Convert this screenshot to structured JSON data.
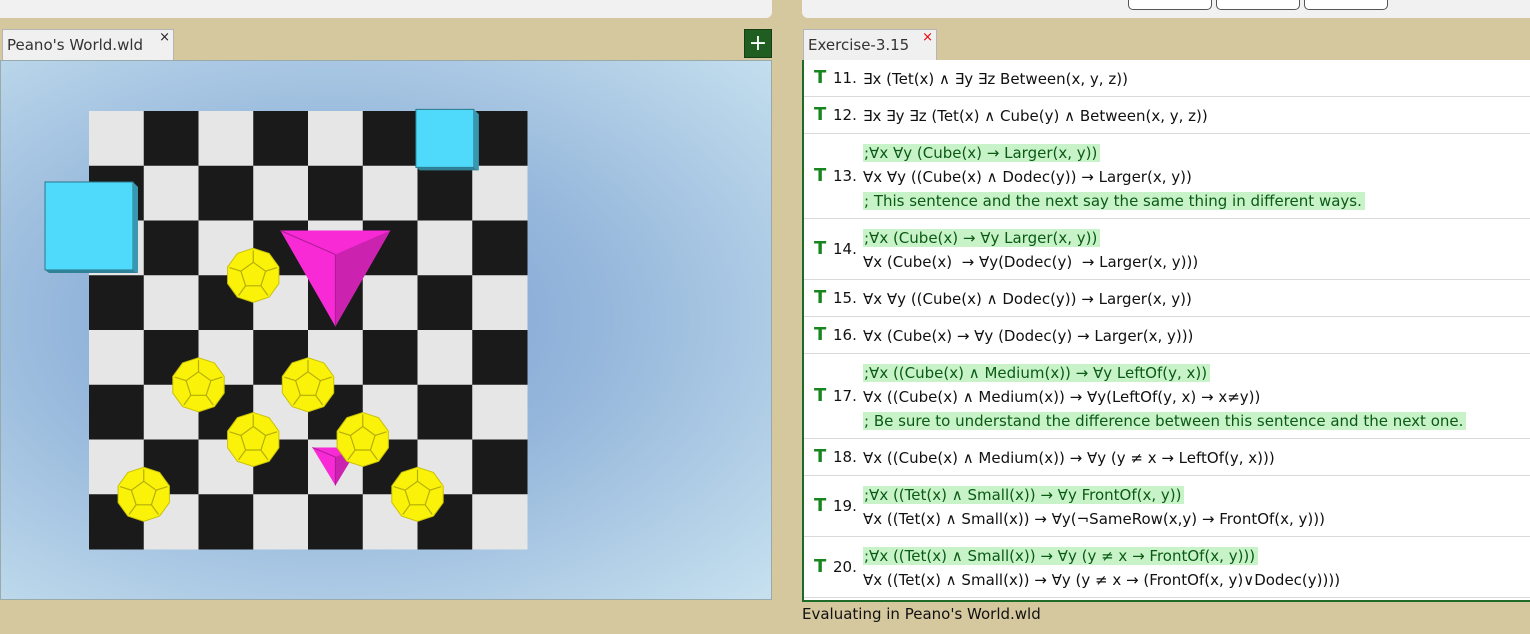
{
  "world_tab": {
    "label": "Peano's World.wld",
    "close": "×"
  },
  "add_button": {
    "label": "+"
  },
  "exercise_tab": {
    "label": "Exercise-3.15",
    "close": "×"
  },
  "status": "Evaluating in Peano's World.wld",
  "sentences": [
    {
      "truth": "T",
      "number": "11.",
      "lines": [
        {
          "text": "∃x (Tet(x) ∧ ∃y ∃z Between(x, y, z))",
          "comment": false
        }
      ]
    },
    {
      "truth": "T",
      "number": "12.",
      "lines": [
        {
          "text": "∃x ∃y ∃z (Tet(x) ∧ Cube(y) ∧ Between(x, y, z))",
          "comment": false
        }
      ]
    },
    {
      "truth": "T",
      "number": "13.",
      "lines": [
        {
          "text": ";∀x ∀y (Cube(x) → Larger(x, y))",
          "comment": true
        },
        {
          "text": "∀x ∀y ((Cube(x) ∧ Dodec(y)) → Larger(x, y))",
          "comment": false
        },
        {
          "text": "; This sentence and the next say the same thing in different ways.",
          "comment": true
        }
      ]
    },
    {
      "truth": "T",
      "number": "14.",
      "lines": [
        {
          "text": ";∀x (Cube(x) → ∀y Larger(x, y))",
          "comment": true
        },
        {
          "text": "∀x (Cube(x)  → ∀y(Dodec(y)  → Larger(x, y)))",
          "comment": false
        }
      ]
    },
    {
      "truth": "T",
      "number": "15.",
      "lines": [
        {
          "text": "∀x ∀y ((Cube(x) ∧ Dodec(y)) → Larger(x, y))",
          "comment": false
        }
      ]
    },
    {
      "truth": "T",
      "number": "16.",
      "lines": [
        {
          "text": "∀x (Cube(x) → ∀y (Dodec(y) → Larger(x, y)))",
          "comment": false
        }
      ]
    },
    {
      "truth": "T",
      "number": "17.",
      "lines": [
        {
          "text": ";∀x ((Cube(x) ∧ Medium(x)) → ∀y LeftOf(y, x))",
          "comment": true
        },
        {
          "text": "∀x ((Cube(x) ∧ Medium(x)) → ∀y(LeftOf(y, x) → x≠y))",
          "comment": false
        },
        {
          "text": "; Be sure to understand the difference between this sentence and the next one.",
          "comment": true
        }
      ]
    },
    {
      "truth": "T",
      "number": "18.",
      "lines": [
        {
          "text": "∀x ((Cube(x) ∧ Medium(x)) → ∀y (y ≠ x → LeftOf(y, x)))",
          "comment": false
        }
      ]
    },
    {
      "truth": "T",
      "number": "19.",
      "lines": [
        {
          "text": ";∀x ((Tet(x) ∧ Small(x)) → ∀y FrontOf(x, y))",
          "comment": true
        },
        {
          "text": "∀x ((Tet(x) ∧ Small(x)) → ∀y(¬SameRow(x,y) → FrontOf(x, y)))",
          "comment": false
        }
      ]
    },
    {
      "truth": "T",
      "number": "20.",
      "lines": [
        {
          "text": ";∀x ((Tet(x) ∧ Small(x)) → ∀y (y ≠ x → FrontOf(x, y)))",
          "comment": true
        },
        {
          "text": "∀x ((Tet(x) ∧ Small(x)) → ∀y (y ≠ x → (FrontOf(x, y)∨Dodec(y))))",
          "comment": false
        }
      ]
    }
  ],
  "world": {
    "colors": {
      "dark": "#1a1a1a",
      "light": "#e6e6e6",
      "cube": "#4fd9fb",
      "tet": "#f72ad6",
      "dodec": "#fbf20a"
    },
    "objects": [
      {
        "shape": "cube",
        "size": "medium",
        "col": 6,
        "row": 0
      },
      {
        "shape": "cube",
        "size": "large",
        "col": -0.5,
        "row": 1.6
      },
      {
        "shape": "tet",
        "size": "large",
        "col": 4,
        "row": 2
      },
      {
        "shape": "tet",
        "size": "small",
        "col": 4,
        "row": 6
      },
      {
        "shape": "dodec",
        "size": "small",
        "col": 2.5,
        "row": 2.5
      },
      {
        "shape": "dodec",
        "size": "small",
        "col": 1.5,
        "row": 4.5
      },
      {
        "shape": "dodec",
        "size": "small",
        "col": 3.5,
        "row": 4.5
      },
      {
        "shape": "dodec",
        "size": "small",
        "col": 2.5,
        "row": 5.5
      },
      {
        "shape": "dodec",
        "size": "small",
        "col": 4.5,
        "row": 5.5
      },
      {
        "shape": "dodec",
        "size": "small",
        "col": 0.5,
        "row": 6.5
      },
      {
        "shape": "dodec",
        "size": "small",
        "col": 5.5,
        "row": 6.5
      }
    ]
  }
}
